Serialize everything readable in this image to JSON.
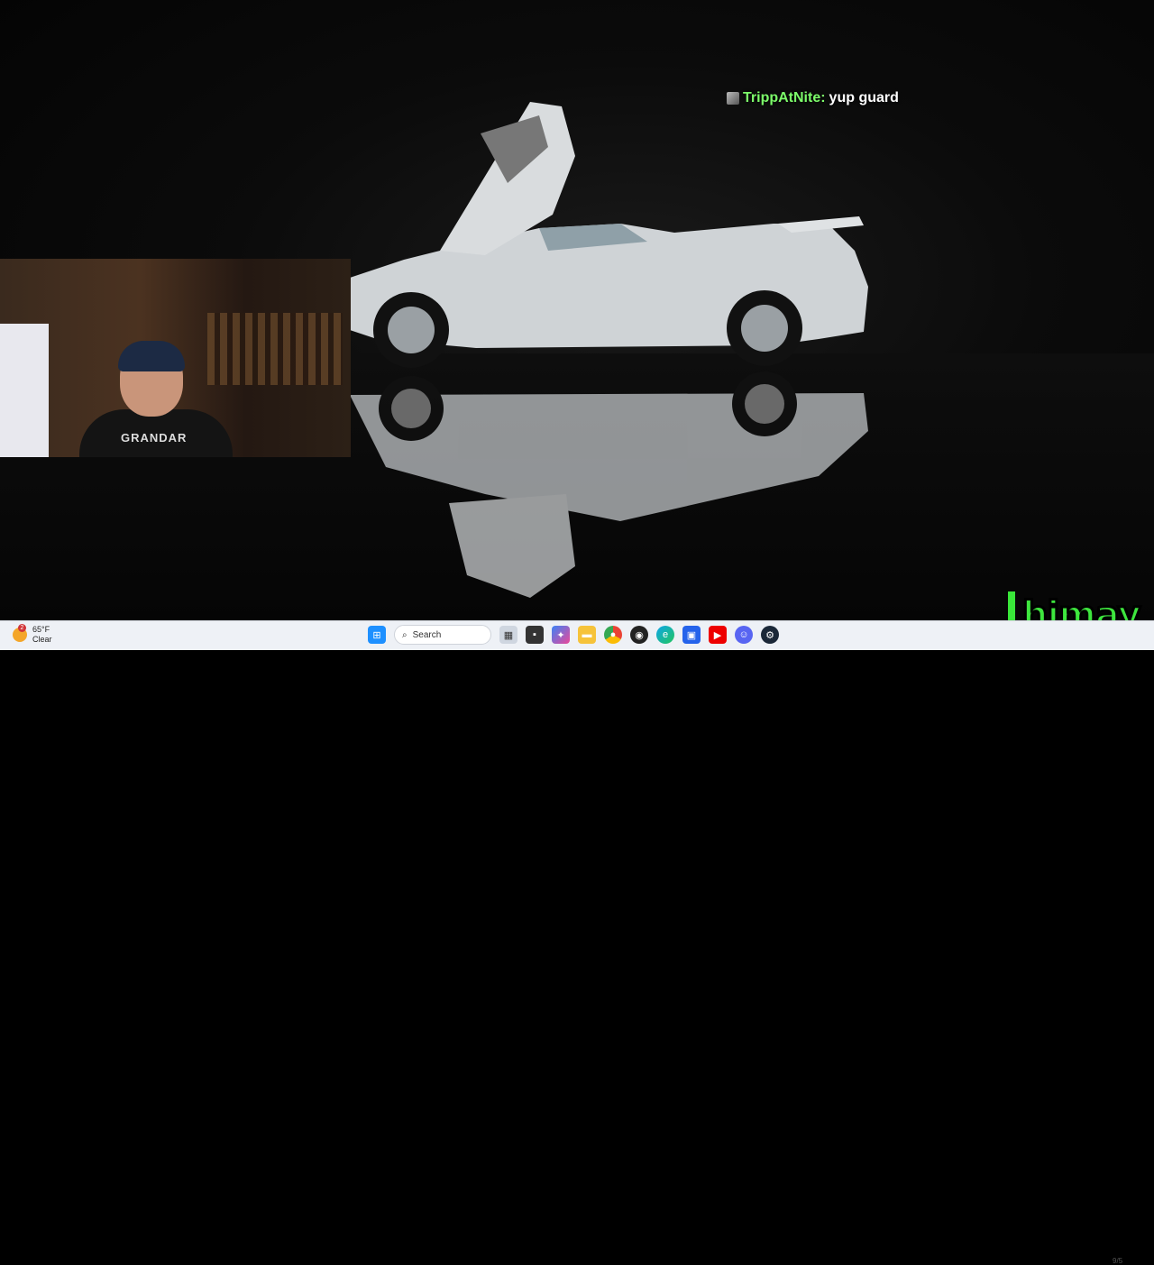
{
  "chat": {
    "username": "TrippAtNite:",
    "message": "yup guard"
  },
  "webcam": {
    "shirt_text": "GRANDAR"
  },
  "taskbar": {
    "weather": {
      "temp": "65°F",
      "condition": "Clear",
      "alert_count": "2"
    },
    "search_placeholder": "Search",
    "date_partial": "9/5"
  },
  "overlay": {
    "brand_name": "himay",
    "brand_color": "#3ee63e"
  },
  "icons": [
    "windows-start-icon",
    "search-icon",
    "widgets-icon",
    "task-view-icon",
    "copilot-icon",
    "file-explorer-icon",
    "chrome-icon",
    "obs-icon",
    "edge-icon",
    "store-icon",
    "youtube-icon",
    "discord-icon",
    "steam-icon"
  ]
}
